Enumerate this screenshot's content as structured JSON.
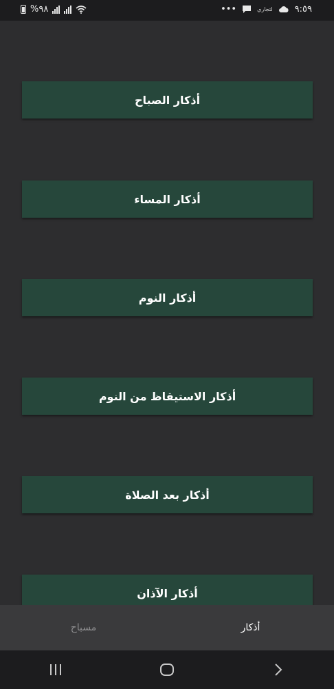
{
  "status_bar": {
    "time": "٩:٥٩",
    "carrier_label": "لتجاري",
    "overflow_dots": "•••",
    "battery_text": "%٩٨"
  },
  "azkar_list": [
    {
      "label": "أذكار الصباح"
    },
    {
      "label": "أذكار المساء"
    },
    {
      "label": "أذكار النوم"
    },
    {
      "label": "أذكار الاستيقاظ من النوم"
    },
    {
      "label": "أذكار بعد الصلاة"
    },
    {
      "label": "أذكار الآذان"
    }
  ],
  "bottom_nav": {
    "tabs": [
      {
        "label": "أذكار",
        "active": true
      },
      {
        "label": "مسباح",
        "active": false
      }
    ]
  },
  "colors": {
    "background": "#2d2d2f",
    "button": "#26473b",
    "bottom_nav": "#3a3a3c",
    "system_bar": "#1c1c1e"
  }
}
